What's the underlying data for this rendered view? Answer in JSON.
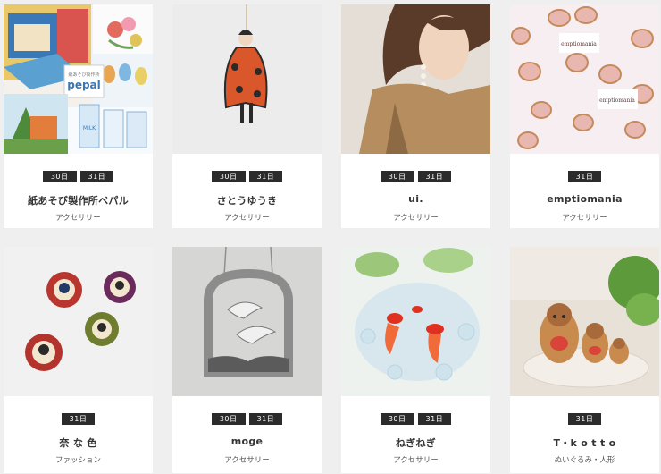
{
  "shops": [
    {
      "name": "紙あそび製作所ペパル",
      "category": "アクセサリー",
      "days": [
        "30日",
        "31日"
      ],
      "logo_text": "pepal"
    },
    {
      "name": "さとうゆうき",
      "category": "アクセサリー",
      "days": [
        "30日",
        "31日"
      ]
    },
    {
      "name": "ui.",
      "category": "アクセサリー",
      "days": [
        "30日",
        "31日"
      ]
    },
    {
      "name": "emptiomania",
      "category": "アクセサリー",
      "days": [
        "31日"
      ],
      "logo_text": "emptiomania"
    },
    {
      "name": "奈 な 色",
      "category": "ファッション",
      "days": [
        "31日"
      ]
    },
    {
      "name": "moge",
      "category": "アクセサリー",
      "days": [
        "30日",
        "31日"
      ]
    },
    {
      "name": "ねぎねぎ",
      "category": "アクセサリー",
      "days": [
        "30日",
        "31日"
      ]
    },
    {
      "name": "T・k o t t o",
      "category": "ぬいぐるみ・人形",
      "days": [
        "31日"
      ]
    }
  ]
}
